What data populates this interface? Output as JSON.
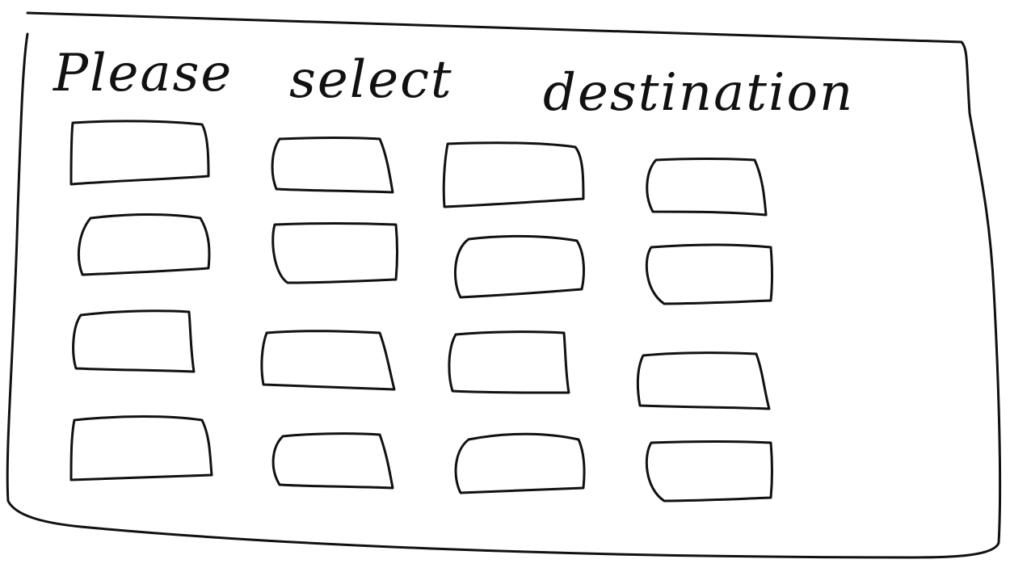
{
  "screen": {
    "title_words": [
      "Please",
      "select",
      "destination"
    ]
  },
  "destinations": {
    "rows": 4,
    "columns": 4,
    "buttons": [
      {
        "label": ""
      },
      {
        "label": ""
      },
      {
        "label": ""
      },
      {
        "label": ""
      },
      {
        "label": ""
      },
      {
        "label": ""
      },
      {
        "label": ""
      },
      {
        "label": ""
      },
      {
        "label": ""
      },
      {
        "label": ""
      },
      {
        "label": ""
      },
      {
        "label": ""
      },
      {
        "label": ""
      },
      {
        "label": ""
      },
      {
        "label": ""
      },
      {
        "label": ""
      }
    ]
  },
  "colors": {
    "ink": "#111111",
    "paper": "#ffffff"
  }
}
